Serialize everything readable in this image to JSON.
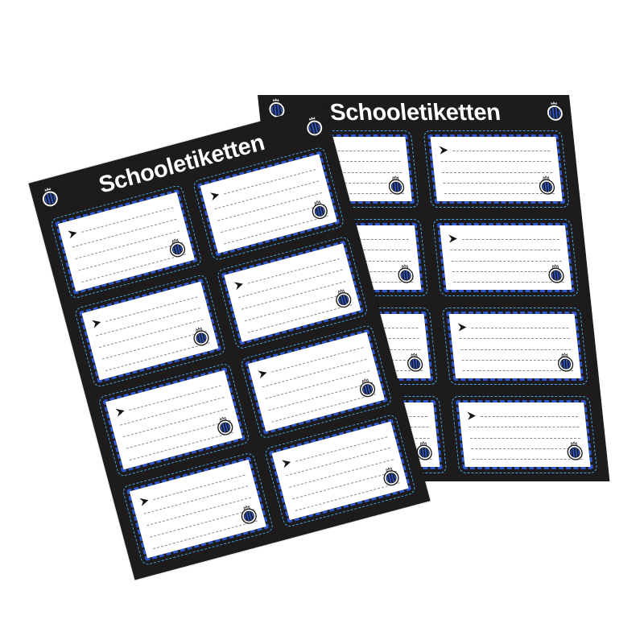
{
  "sheets": [
    {
      "title": "Schooletiketten"
    },
    {
      "title": "Schooletiketten"
    }
  ],
  "icons": {
    "label_arrow": "arrow-chevron-icon",
    "crest": "club-crest-icon"
  },
  "colors": {
    "page_background": "#ffffff",
    "sheet": "#1d1b1c",
    "label": "#ffffff",
    "label_border": "#2d58d2",
    "cut_line": "#46abe8",
    "writing_line": "#8c8c8c",
    "title_text": "#ffffff"
  }
}
